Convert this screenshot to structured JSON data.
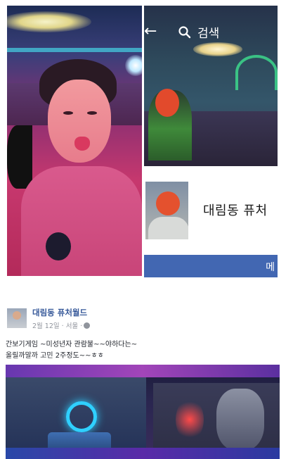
{
  "profile_screenshot": {
    "search_label": "검색",
    "page_name": "대림동 퓨처",
    "button_label": "메"
  },
  "post": {
    "author": "대림동 퓨처월드",
    "meta": "2월 12일 · 서울 ·",
    "text_line1": "간보기게임 ~미성년자 관람불~~야하다는~",
    "text_line2": "올릴까말까 고민 2주정도~~ㅎㅎ"
  },
  "colors": {
    "facebook_blue": "#4267b2",
    "author_link": "#365899",
    "meta_gray": "#90949c"
  }
}
